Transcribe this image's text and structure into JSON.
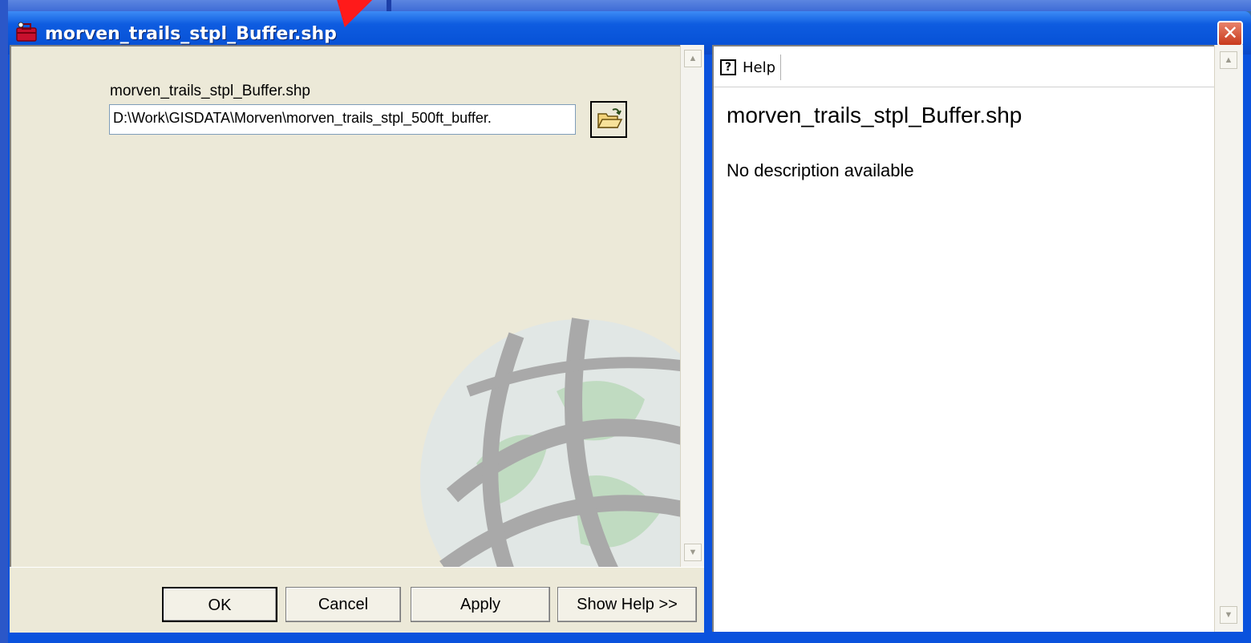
{
  "window": {
    "title": "morven_trails_stpl_Buffer.shp",
    "close_glyph": "✕",
    "title_icon": "toolbox-icon"
  },
  "form": {
    "param_label": "morven_trails_stpl_Buffer.shp",
    "path_value": "D:\\Work\\GISDATA\\Morven\\morven_trails_stpl_500ft_buffer.",
    "browse_icon": "open-folder-icon"
  },
  "buttons": {
    "ok": "OK",
    "cancel": "Cancel",
    "apply": "Apply",
    "show_help": "Show Help >>"
  },
  "help": {
    "tab_label": "Help",
    "tab_icon_glyph": "?",
    "title": "morven_trails_stpl_Buffer.shp",
    "description": "No description available"
  },
  "scroll": {
    "up_glyph": "▲",
    "down_glyph": "▼"
  },
  "colors": {
    "titlebar": "#0853d8",
    "dialog_bg": "#ece9d8",
    "close_button": "#c8391c",
    "annotation_arrow": "#ff1a1a"
  }
}
